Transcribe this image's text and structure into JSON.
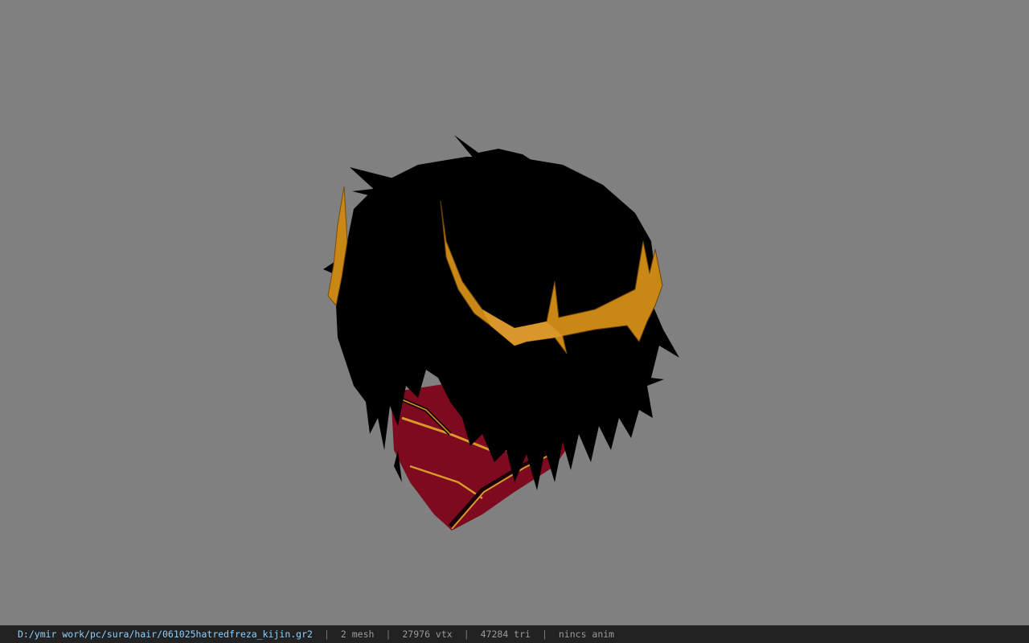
{
  "viewport": {
    "background_color": "#808080",
    "model_description_colors": {
      "hair": "#000000",
      "gold_trim": "#d08a1c",
      "mask": "#8a0a22"
    }
  },
  "status_bar": {
    "path": "D:/ymir work/pc/sura/hair/061025hatredfreza_kijin.gr2",
    "mesh": "2 mesh",
    "vertices": "27976 vtx",
    "triangles": "47284 tri",
    "anim": "nincs anim",
    "separator": "|"
  }
}
